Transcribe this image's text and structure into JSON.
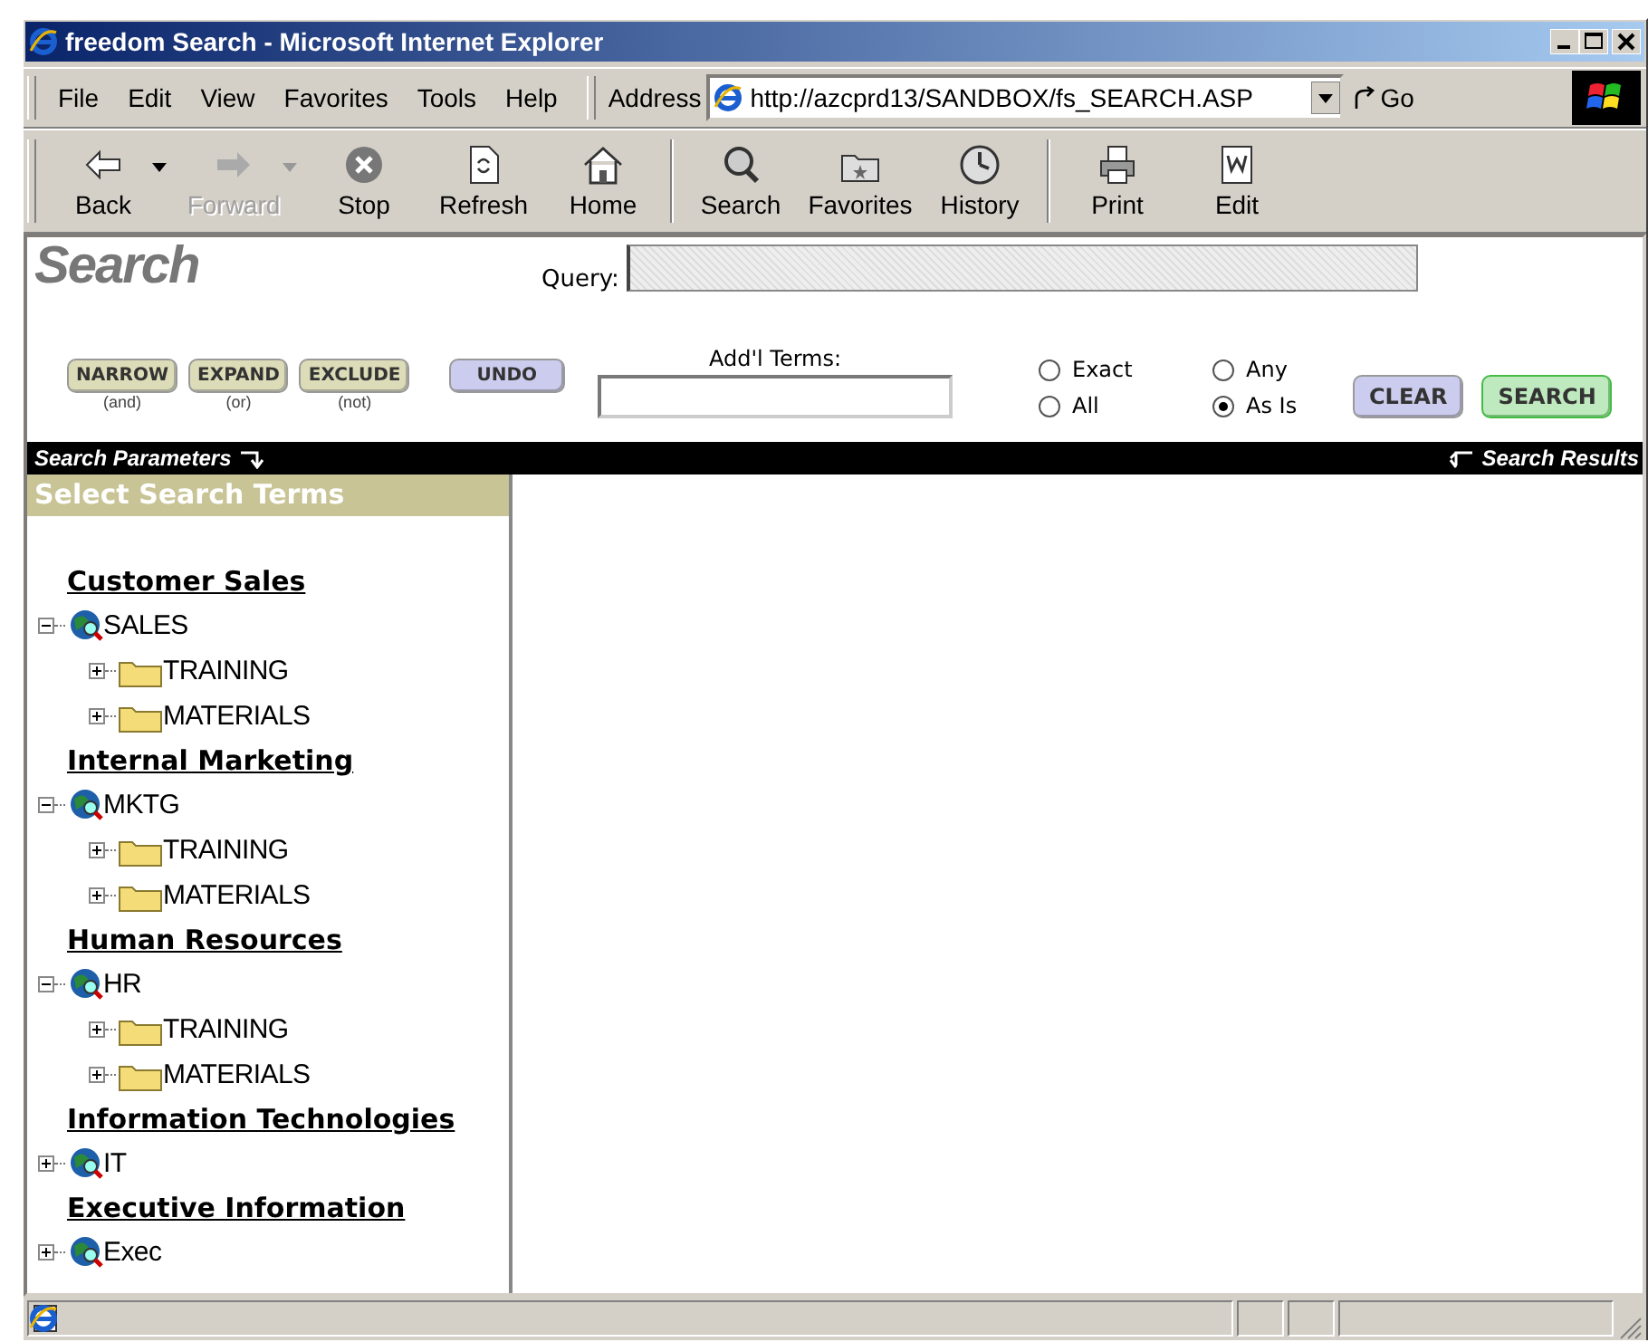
{
  "window": {
    "title": "freedom Search - Microsoft Internet Explorer"
  },
  "menu": [
    "File",
    "Edit",
    "View",
    "Favorites",
    "Tools",
    "Help"
  ],
  "address": {
    "label": "Address",
    "url": "http://azcprd13/SANDBOX/fs_SEARCH.ASP",
    "go": "Go"
  },
  "toolbar": [
    {
      "kind": "back",
      "label": "Back",
      "disabled": false,
      "dropdown": true
    },
    {
      "kind": "forward",
      "label": "Forward",
      "disabled": true,
      "dropdown": true
    },
    {
      "kind": "stop",
      "label": "Stop",
      "disabled": false,
      "dropdown": false
    },
    {
      "kind": "refresh",
      "label": "Refresh",
      "disabled": false,
      "dropdown": false
    },
    {
      "kind": "home",
      "label": "Home",
      "disabled": false,
      "dropdown": false
    },
    {
      "kind": "separator"
    },
    {
      "kind": "search",
      "label": "Search",
      "disabled": false,
      "dropdown": false
    },
    {
      "kind": "favorites",
      "label": "Favorites",
      "disabled": false,
      "dropdown": false
    },
    {
      "kind": "history",
      "label": "History",
      "disabled": false,
      "dropdown": false
    },
    {
      "kind": "separator"
    },
    {
      "kind": "print",
      "label": "Print",
      "disabled": false,
      "dropdown": false
    },
    {
      "kind": "edit",
      "label": "Edit",
      "disabled": false,
      "dropdown": false
    }
  ],
  "page": {
    "heading": "Search",
    "query_label": "Query:",
    "operators": [
      {
        "label": "NARROW",
        "caption": "(and)"
      },
      {
        "label": "EXPAND",
        "caption": "(or)"
      },
      {
        "label": "EXCLUDE",
        "caption": "(not)"
      }
    ],
    "undo": "UNDO",
    "terms_label": "Add'l Terms:",
    "options": [
      {
        "label": "Exact",
        "selected": false
      },
      {
        "label": "Any",
        "selected": false
      },
      {
        "label": "All",
        "selected": false
      },
      {
        "label": "As Is",
        "selected": true
      }
    ],
    "clear": "CLEAR",
    "search": "SEARCH"
  },
  "bar": {
    "left": "Search Parameters",
    "right": "Search Results"
  },
  "sidebar": {
    "title": "Select Search Terms",
    "groups": [
      {
        "heading": "Customer Sales",
        "root": {
          "label": "SALES",
          "expanded": true,
          "children": [
            {
              "label": "TRAINING",
              "expanded": false
            },
            {
              "label": "MATERIALS",
              "expanded": false
            }
          ]
        }
      },
      {
        "heading": "Internal Marketing",
        "root": {
          "label": "MKTG",
          "expanded": true,
          "children": [
            {
              "label": "TRAINING",
              "expanded": false
            },
            {
              "label": "MATERIALS",
              "expanded": false
            }
          ]
        }
      },
      {
        "heading": "Human Resources",
        "root": {
          "label": "HR",
          "expanded": true,
          "children": [
            {
              "label": "TRAINING",
              "expanded": false
            },
            {
              "label": "MATERIALS",
              "expanded": false
            }
          ]
        }
      },
      {
        "heading": "Information Technologies",
        "root": {
          "label": "IT",
          "expanded": false
        }
      },
      {
        "heading": "Executive Information",
        "root": {
          "label": "Exec",
          "expanded": false
        }
      }
    ]
  }
}
